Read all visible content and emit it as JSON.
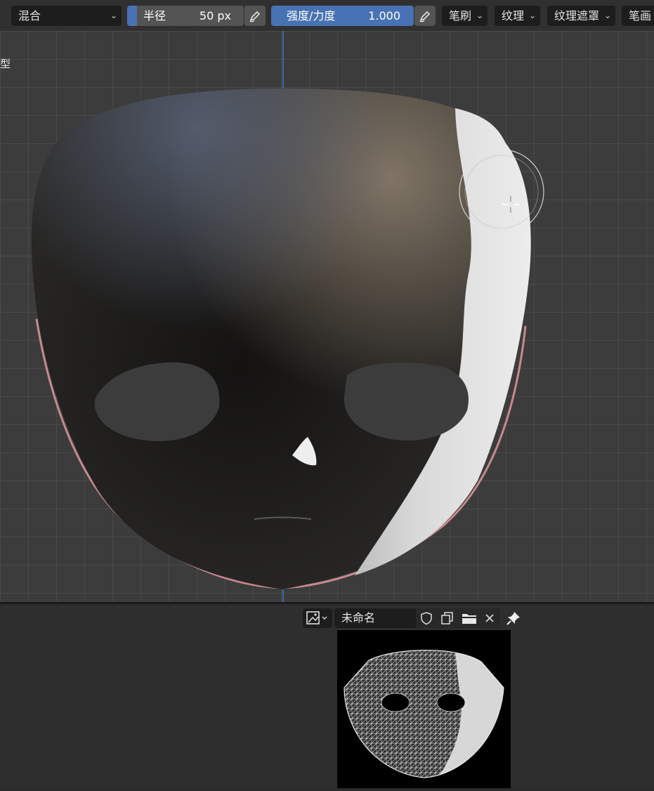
{
  "header": {
    "blend_dropdown": {
      "label": "混合"
    },
    "radius_slider": {
      "label": "半径",
      "value": "50 px"
    },
    "strength_slider": {
      "label": "强度/力度",
      "value": "1.000"
    },
    "menus": [
      "笔刷",
      "纹理",
      "纹理遮罩",
      "笔画"
    ]
  },
  "viewport": {
    "mode_label": "型"
  },
  "image_editor": {
    "image_name": "未命名"
  },
  "colors": {
    "accent": "#4772b3",
    "background": "#3c3c3c",
    "header": "#303030"
  },
  "icons": [
    "pen-pressure-icon",
    "image-type-icon",
    "fake-user-shield-icon",
    "duplicate-icon",
    "open-folder-icon",
    "close-icon",
    "pin-icon",
    "brush-cursor-icon"
  ]
}
